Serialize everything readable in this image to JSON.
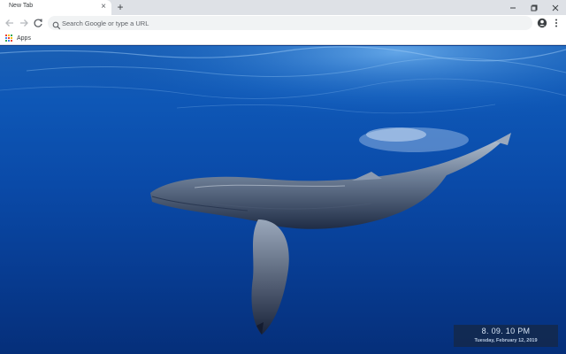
{
  "tab": {
    "title": "New Tab",
    "close_glyph": "×"
  },
  "tabstrip": {
    "new_tab_glyph": "+"
  },
  "window_controls": [
    "minimize-icon",
    "maximize-icon",
    "close-icon"
  ],
  "toolbar": {
    "back_icon": "arrow-left-icon",
    "forward_icon": "arrow-right-icon",
    "reload_icon": "reload-icon",
    "omnibox_placeholder": "Search Google or type a URL",
    "omnibox_value": "",
    "star_icon": "star-icon",
    "profile_icon": "account-icon",
    "menu_icon": "kebab-menu-icon"
  },
  "bookmarks": {
    "apps_label": "Apps"
  },
  "wallpaper": {
    "subject": "whale-underwater"
  },
  "clock": {
    "time": "8. 09. 10 PM",
    "date": "Tuesday, February 12, 2019"
  },
  "colors": {
    "tabstrip": "#dee1e6",
    "toolbar": "#ffffff",
    "omnibox": "#f1f3f4",
    "ocean": "#0a4aa8",
    "clock_bg": "#142846"
  }
}
